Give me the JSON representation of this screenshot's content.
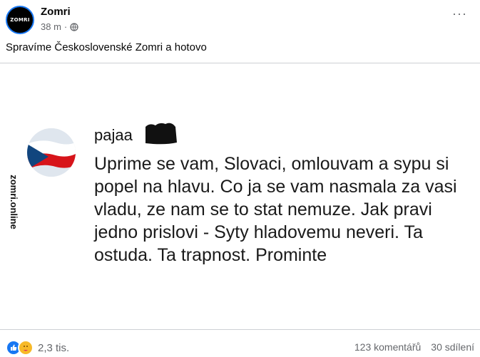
{
  "post": {
    "page_name": "Zomri",
    "avatar_logo_text": "ZOMRI",
    "time": "38 m",
    "separator": "·",
    "privacy_icon": "globe-icon",
    "more_icon": "more-dots-icon",
    "more_label": "···",
    "caption": "Spravíme Československé Zomri a hotovo"
  },
  "image": {
    "watermark": "zomri.online",
    "comment": {
      "author": "pajaa",
      "text": "Uprime se vam, Slovaci, omlouvam a sypu si popel na hlavu. Co ja se vam nasmala za vasi vladu, ze nam se to stat nemuze. Jak pravi jedno prislovi - Syty hladovemu neveri. Ta ostuda. Ta trapnost. Prominte",
      "avatar_icon": "czech-flag-avatar"
    }
  },
  "footer": {
    "reaction_icons": [
      "like-icon",
      "care-icon"
    ],
    "reactions_count": "2,3 tis.",
    "comments": "123 komentářů",
    "shares": "30 sdílení"
  },
  "colors": {
    "accent": "#1877f2",
    "secondary_text": "#65676b",
    "flag_white": "#ffffff",
    "flag_red": "#d7141a",
    "flag_blue": "#11457e"
  }
}
